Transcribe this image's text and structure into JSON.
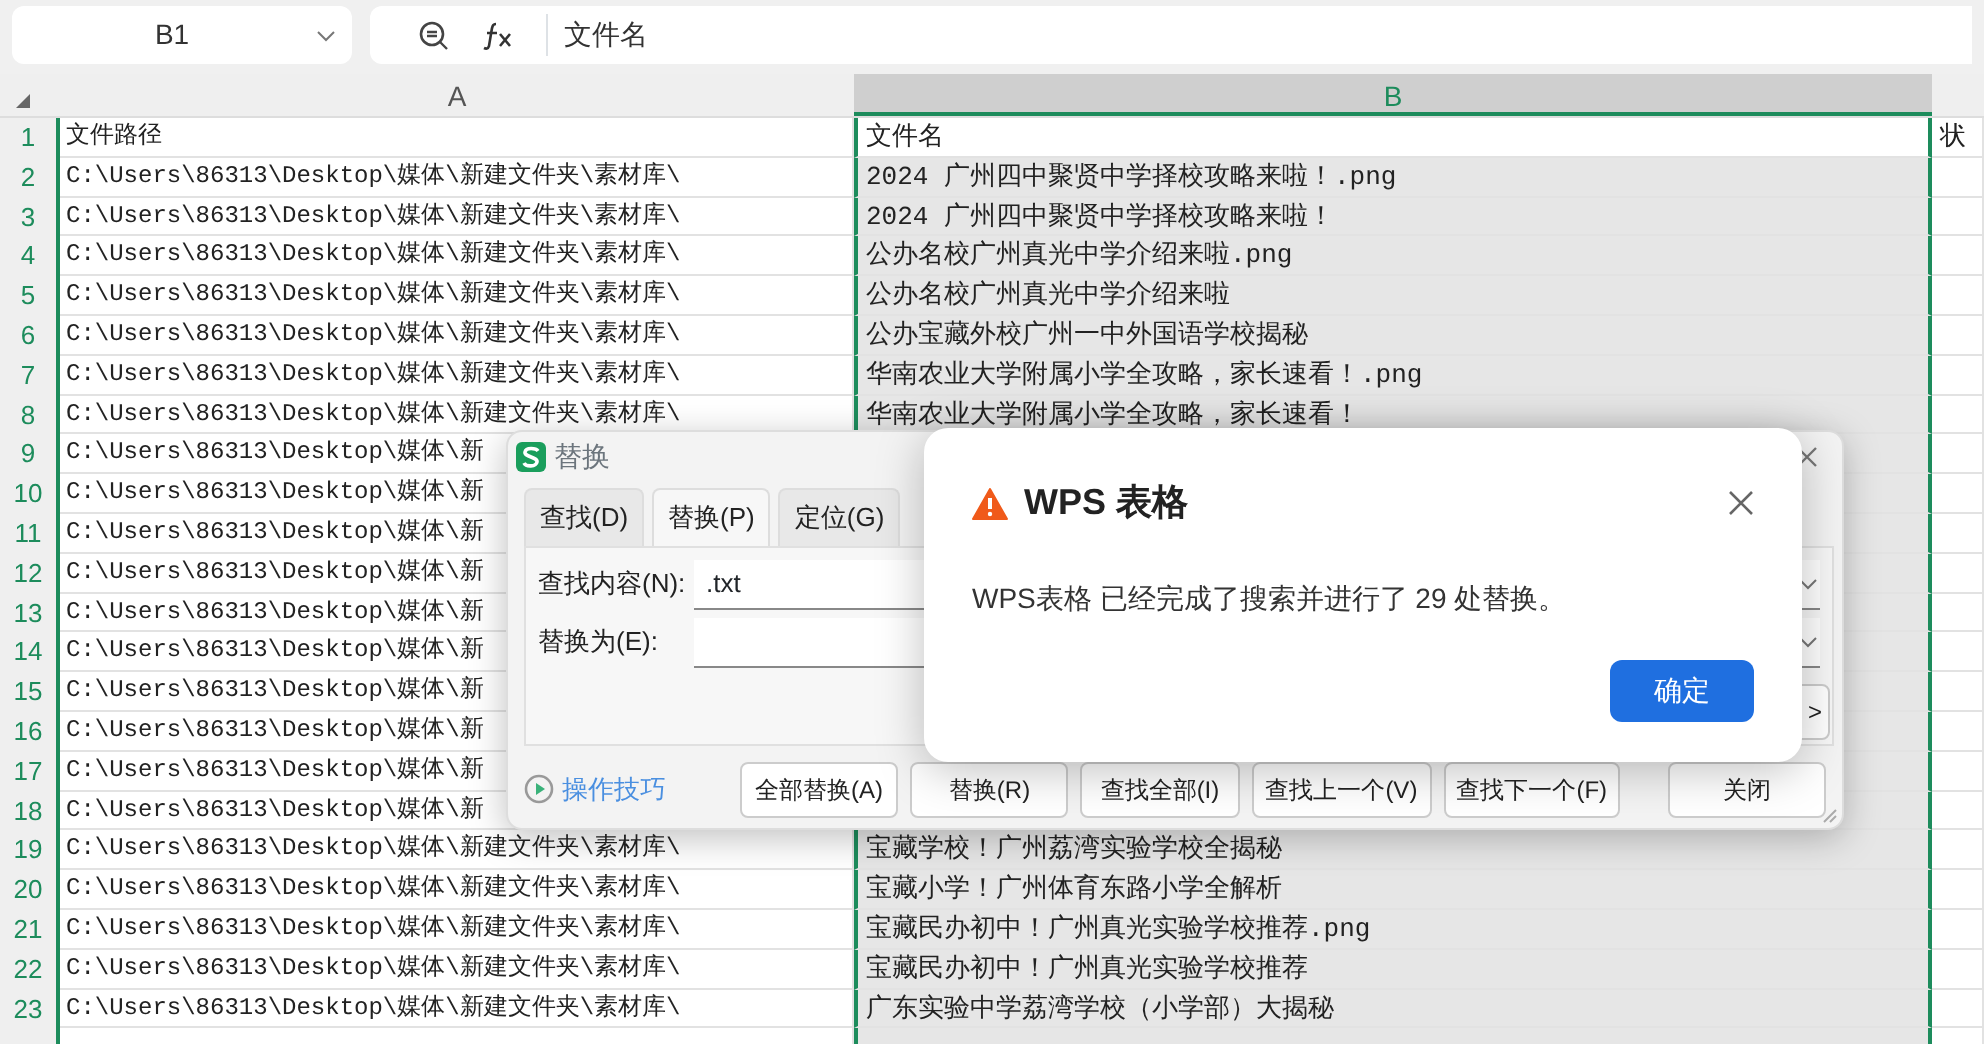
{
  "name_box": {
    "value": "B1"
  },
  "formula_bar": {
    "value": "文件名"
  },
  "columns": [
    {
      "label": "A",
      "selected": false
    },
    {
      "label": "B",
      "selected": true
    }
  ],
  "rows": [
    {
      "number": "1",
      "a": "文件路径",
      "b": "文件名",
      "b_active": true,
      "c": "状"
    },
    {
      "number": "2",
      "a": "C:\\Users\\86313\\Desktop\\媒体\\新建文件夹\\素材库\\",
      "b": "2024 广州四中聚贤中学择校攻略来啦！.png",
      "b_active": false
    },
    {
      "number": "3",
      "a": "C:\\Users\\86313\\Desktop\\媒体\\新建文件夹\\素材库\\",
      "b": "2024 广州四中聚贤中学择校攻略来啦！",
      "b_active": false
    },
    {
      "number": "4",
      "a": "C:\\Users\\86313\\Desktop\\媒体\\新建文件夹\\素材库\\",
      "b": "公办名校广州真光中学介绍来啦.png",
      "b_active": false
    },
    {
      "number": "5",
      "a": "C:\\Users\\86313\\Desktop\\媒体\\新建文件夹\\素材库\\",
      "b": "公办名校广州真光中学介绍来啦",
      "b_active": false
    },
    {
      "number": "6",
      "a": "C:\\Users\\86313\\Desktop\\媒体\\新建文件夹\\素材库\\",
      "b": "公办宝藏外校广州一中外国语学校揭秘",
      "b_active": false
    },
    {
      "number": "7",
      "a": "C:\\Users\\86313\\Desktop\\媒体\\新建文件夹\\素材库\\",
      "b": "华南农业大学附属小学全攻略，家长速看！.png",
      "b_active": false
    },
    {
      "number": "8",
      "a": "C:\\Users\\86313\\Desktop\\媒体\\新建文件夹\\素材库\\",
      "b": "华南农业大学附属小学全攻略，家长速看！",
      "b_active": false
    },
    {
      "number": "9",
      "a": "C:\\Users\\86313\\Desktop\\媒体\\新"
    },
    {
      "number": "10",
      "a": "C:\\Users\\86313\\Desktop\\媒体\\新"
    },
    {
      "number": "11",
      "a": "C:\\Users\\86313\\Desktop\\媒体\\新"
    },
    {
      "number": "12",
      "a": "C:\\Users\\86313\\Desktop\\媒体\\新"
    },
    {
      "number": "13",
      "a": "C:\\Users\\86313\\Desktop\\媒体\\新"
    },
    {
      "number": "14",
      "a": "C:\\Users\\86313\\Desktop\\媒体\\新"
    },
    {
      "number": "15",
      "a": "C:\\Users\\86313\\Desktop\\媒体\\新"
    },
    {
      "number": "16",
      "a": "C:\\Users\\86313\\Desktop\\媒体\\新"
    },
    {
      "number": "17",
      "a": "C:\\Users\\86313\\Desktop\\媒体\\新"
    },
    {
      "number": "18",
      "a": "C:\\Users\\86313\\Desktop\\媒体\\新"
    },
    {
      "number": "19",
      "a": "C:\\Users\\86313\\Desktop\\媒体\\新建文件夹\\素材库\\",
      "b": "宝藏学校！广州荔湾实验学校全揭秘",
      "b_active": false
    },
    {
      "number": "20",
      "a": "C:\\Users\\86313\\Desktop\\媒体\\新建文件夹\\素材库\\",
      "b": "宝藏小学！广州体育东路小学全解析",
      "b_active": false
    },
    {
      "number": "21",
      "a": "C:\\Users\\86313\\Desktop\\媒体\\新建文件夹\\素材库\\",
      "b": "宝藏民办初中！广州真光实验学校推荐.png",
      "b_active": false
    },
    {
      "number": "22",
      "a": "C:\\Users\\86313\\Desktop\\媒体\\新建文件夹\\素材库\\",
      "b": "宝藏民办初中！广州真光实验学校推荐",
      "b_active": false
    },
    {
      "number": "23",
      "a": "C:\\Users\\86313\\Desktop\\媒体\\新建文件夹\\素材库\\",
      "b": "广东实验中学荔湾学校（小学部）大揭秘",
      "b_active": false
    }
  ],
  "replace_dialog": {
    "title": "替换",
    "tabs": [
      {
        "label": "查找(D)",
        "selected": false
      },
      {
        "label": "替换(P)",
        "selected": true
      },
      {
        "label": "定位(G)",
        "selected": false
      }
    ],
    "find_label": "查找内容(N):",
    "find_value": ".txt",
    "replace_label": "替换为(E):",
    "options_button": ">",
    "tips_link": "操作技巧",
    "buttons": [
      "全部替换(A)",
      "替换(R)",
      "查找全部(I)",
      "查找上一个(V)",
      "查找下一个(F)",
      "关闭"
    ]
  },
  "alert": {
    "title": "WPS 表格",
    "message": "WPS表格 已经完成了搜索并进行了 29 处替换。",
    "ok_button": "确定"
  }
}
